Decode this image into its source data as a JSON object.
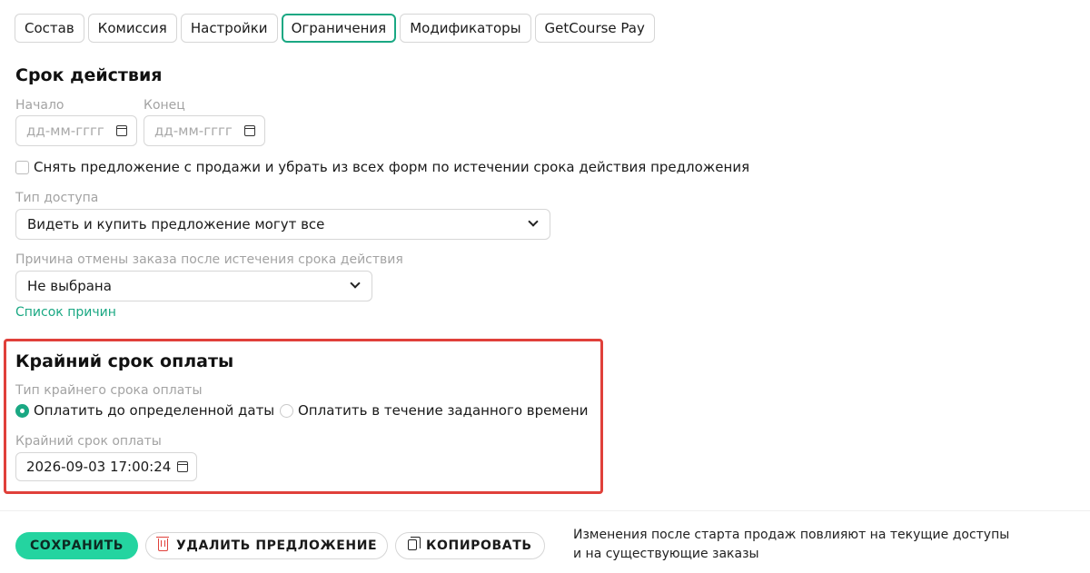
{
  "tabs": [
    {
      "label": "Состав"
    },
    {
      "label": "Комиссия"
    },
    {
      "label": "Настройки"
    },
    {
      "label": "Ограничения",
      "active": true
    },
    {
      "label": "Модификаторы"
    },
    {
      "label": "GetCourse Pay"
    }
  ],
  "validity": {
    "title": "Срок действия",
    "start_label": "Начало",
    "start_placeholder": "дд-мм-гггг",
    "end_label": "Конец",
    "end_placeholder": "дд-мм-гггг",
    "remove_checkbox_label": "Снять предложение с продажи и убрать из всех форм по истечении срока действия предложения",
    "remove_checked": false,
    "access_type_label": "Тип доступа",
    "access_type_value": "Видеть и купить предложение могут все",
    "cancel_reason_label": "Причина отмены заказа после истечения срока действия",
    "cancel_reason_value": "Не выбрана",
    "reasons_link": "Список причин"
  },
  "payment_deadline": {
    "title": "Крайний срок оплаты",
    "type_label": "Тип крайнего срока оплаты",
    "option_date": "Оплатить до определенной даты",
    "option_time": "Оплатить в течение заданного времени",
    "selected": "option_date",
    "deadline_label": "Крайний срок оплаты",
    "deadline_value": "2026-09-03 17:00:24"
  },
  "footer": {
    "save_label": "СОХРАНИТЬ",
    "delete_label": "УДАЛИТЬ ПРЕДЛОЖЕНИЕ",
    "copy_label": "КОПИРОВАТЬ",
    "notice_line1": "Изменения после старта продаж повлияют на текущие доступы",
    "notice_line2": "и на существующие заказы"
  },
  "colors": {
    "accent": "#1aa883",
    "save_button": "#24d4a0",
    "highlight_border": "#e0403a",
    "delete_icon": "#e0403a"
  }
}
